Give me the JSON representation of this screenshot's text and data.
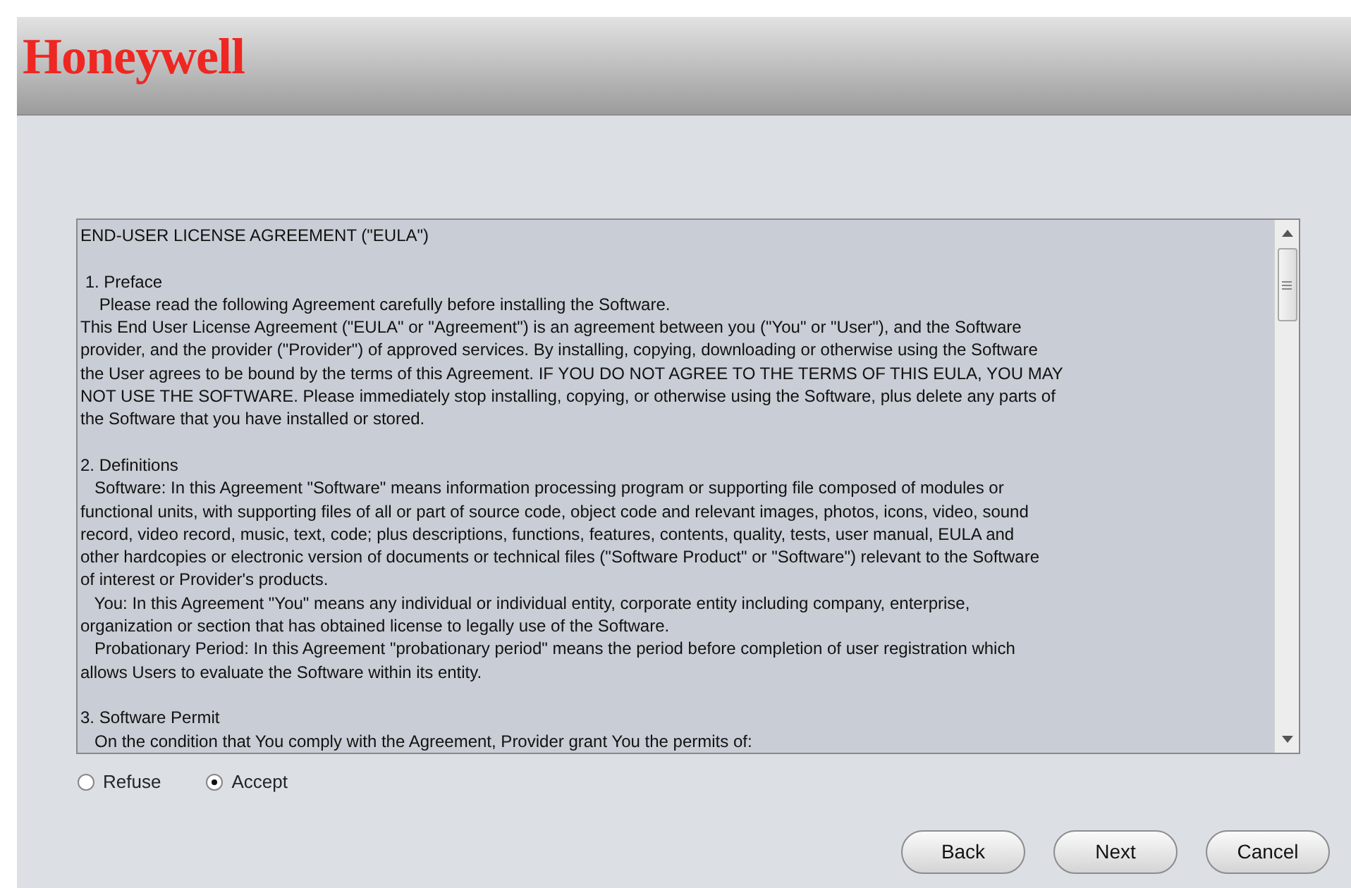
{
  "header": {
    "logo": "Honeywell"
  },
  "eula": {
    "paragraphs": [
      "END-USER LICENSE AGREEMENT (\"EULA\")",
      " 1. Preface\n    Please read the following Agreement carefully before installing the Software.\nThis End User License Agreement (\"EULA\" or \"Agreement\") is an agreement between you (\"You\" or \"User\"), and the Software\nprovider, and the provider (\"Provider\") of approved services. By installing, copying, downloading or otherwise using the Software\nthe User agrees to be bound by the terms of this Agreement. IF YOU DO NOT AGREE TO THE TERMS OF THIS EULA, YOU MAY\nNOT USE THE SOFTWARE. Please immediately stop installing, copying, or otherwise using the Software, plus delete any parts of\nthe Software that you have installed or stored.",
      "2. Definitions\n   Software: In this Agreement \"Software\" means information processing program or supporting file composed of modules or\nfunctional units, with supporting files of all or part of source code, object code and relevant images, photos, icons, video, sound\nrecord, video record, music, text, code; plus descriptions, functions, features, contents, quality, tests, user manual, EULA and\nother hardcopies or electronic version of documents or technical files (\"Software Product\" or \"Software\") relevant to the Software\nof interest or Provider's products.\n   You: In this Agreement \"You\" means any individual or individual entity, corporate entity including company, enterprise,\norganization or section that has obtained license to legally use of the Software.\n   Probationary Period: In this Agreement \"probationary period\" means the period before completion of user registration which\nallows Users to evaluate the Software within its entity.",
      "3. Software Permit\n   On the condition that You comply with the Agreement, Provider grant You the permits of:"
    ]
  },
  "choices": [
    {
      "label": "Refuse",
      "selected": false
    },
    {
      "label": "Accept",
      "selected": true
    }
  ],
  "buttons": [
    "Back",
    "Next",
    "Cancel"
  ]
}
